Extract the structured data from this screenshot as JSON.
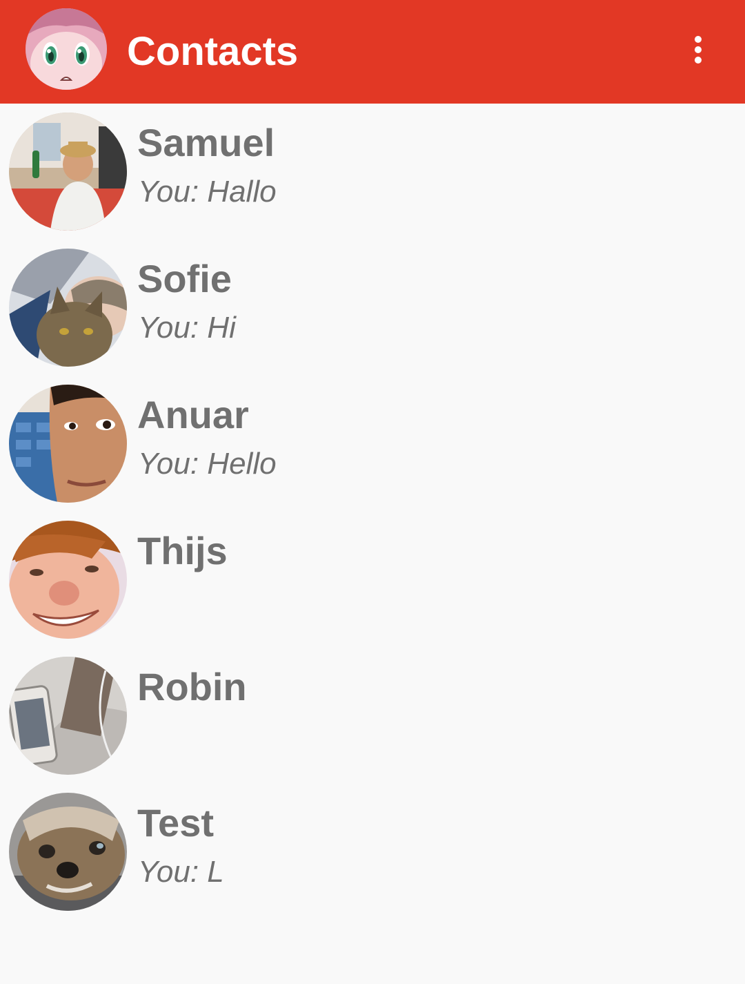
{
  "app_bar": {
    "title": "Contacts",
    "background_color": "#e23825",
    "avatar_icon": "anime-girl-avatar",
    "menu_icon": "more-vert-icon"
  },
  "contacts": [
    {
      "name": "Samuel",
      "last_message": "You: Hallo",
      "avatar": "man-with-hat-photo"
    },
    {
      "name": "Sofie",
      "last_message": "You: Hi",
      "avatar": "person-with-cat-photo"
    },
    {
      "name": "Anuar",
      "last_message": "You: Hello",
      "avatar": "man-face-closeup-photo"
    },
    {
      "name": "Thijs",
      "last_message": "",
      "avatar": "smiling-boy-closeup-photo"
    },
    {
      "name": "Robin",
      "last_message": "",
      "avatar": "phone-on-table-photo"
    },
    {
      "name": "Test",
      "last_message": "You: L",
      "avatar": "small-dog-photo"
    }
  ],
  "colors": {
    "text": "#707070",
    "background": "#f9f9f9"
  }
}
